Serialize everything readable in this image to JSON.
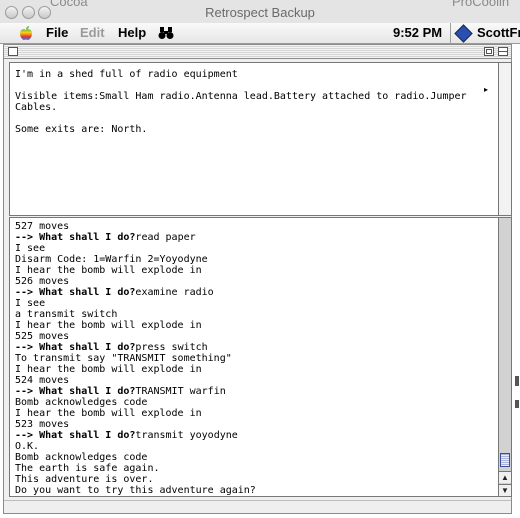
{
  "background": {
    "left_window_fragment": "Cocoa",
    "right_window_fragment": "ProCoolin"
  },
  "app_title": "Retrospect Backup",
  "menubar": {
    "file": "File",
    "edit": "Edit",
    "help": "Help",
    "clock": "9:52 PM",
    "user": "ScottFr"
  },
  "upper": {
    "text": "I'm in a shed full of radio equipment\n\nVisible items:Small Ham radio.Antenna lead.Battery attached to radio.Jumper\nCables.\n\nSome exits are: North."
  },
  "transcript": [
    {
      "text": "527 moves"
    },
    {
      "prompt": "--> What shall I do?",
      "text": "read paper"
    },
    {
      "text": "I see"
    },
    {
      "text": "Disarm Code: 1=Warfin 2=Yoyodyne"
    },
    {
      "text": "I hear the bomb will explode in"
    },
    {
      "text": "526 moves"
    },
    {
      "prompt": "--> What shall I do?",
      "text": "examine radio"
    },
    {
      "text": "I see"
    },
    {
      "text": "a transmit switch"
    },
    {
      "text": "I hear the bomb will explode in"
    },
    {
      "text": "525 moves"
    },
    {
      "prompt": "--> What shall I do?",
      "text": "press switch"
    },
    {
      "text": "To transmit say \"TRANSMIT something\""
    },
    {
      "text": "I hear the bomb will explode in"
    },
    {
      "text": "524 moves"
    },
    {
      "prompt": "--> What shall I do?",
      "text": "TRANSMIT warfin"
    },
    {
      "text": "Bomb acknowledges code"
    },
    {
      "text": "I hear the bomb will explode in"
    },
    {
      "text": "523 moves"
    },
    {
      "prompt": "--> What shall I do?",
      "text": "transmit yoyodyne"
    },
    {
      "text": "O.K."
    },
    {
      "text": "Bomb acknowledges code"
    },
    {
      "text": "The earth is safe again."
    },
    {
      "text": "This adventure is over."
    },
    {
      "text": "Do you want to try this adventure again?"
    }
  ],
  "icons": {
    "apple": "apple-menu-icon",
    "binoculars": "find-icon",
    "user": "user-diamond-icon",
    "scroll_up": "▲",
    "scroll_down": "▼",
    "caret": "▸"
  },
  "colors": {
    "thumb": "#aab3da",
    "user_icon": "#2b4fb0"
  }
}
